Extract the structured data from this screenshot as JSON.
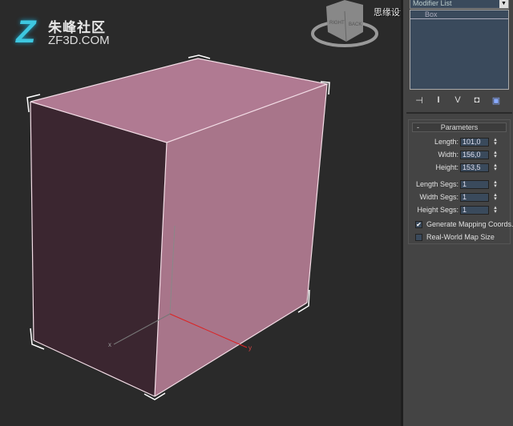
{
  "logo": {
    "mark": "Z",
    "cn": "朱峰社区",
    "en": "ZF3D.COM"
  },
  "watermark": "思缘设计论坛 WWW.MISSYUAN.COM",
  "viewcube": {
    "right": "RIGHT",
    "back": "BACK"
  },
  "viewport": {
    "object_color": "#b07a92",
    "axis_x": "x",
    "axis_y": "y"
  },
  "panel": {
    "modifier_list": "Modifier List",
    "stack": [
      "Box"
    ],
    "toolbar": [
      "pin-stack",
      "show-end-result",
      "make-unique",
      "remove-modifier",
      "configure-modifier-sets"
    ],
    "parameters": {
      "title": "Parameters",
      "collapse": "-",
      "fields": [
        {
          "label": "Length:",
          "value": "101,0"
        },
        {
          "label": "Width:",
          "value": "156,0"
        },
        {
          "label": "Height:",
          "value": "153,5"
        },
        {
          "label": "Length Segs:",
          "value": "1"
        },
        {
          "label": "Width Segs:",
          "value": "1"
        },
        {
          "label": "Height Segs:",
          "value": "1"
        }
      ],
      "checkboxes": [
        {
          "label": "Generate Mapping Coords.",
          "checked": true
        },
        {
          "label": "Real-World Map Size",
          "checked": false
        }
      ]
    }
  }
}
